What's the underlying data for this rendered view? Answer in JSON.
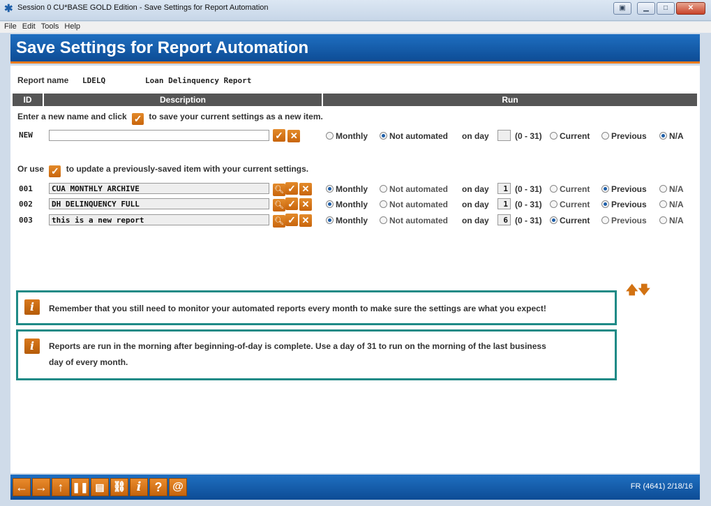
{
  "window": {
    "title": "Session 0 CU*BASE GOLD Edition - Save Settings for Report Automation",
    "menu": [
      "File",
      "Edit",
      "Tools",
      "Help"
    ]
  },
  "page": {
    "title": "Save Settings for Report Automation"
  },
  "report": {
    "name_label": "Report name",
    "code": "LDELQ",
    "description": "Loan Delinquency Report"
  },
  "columns": {
    "id": "ID",
    "description": "Description",
    "run": "Run"
  },
  "new_item": {
    "instruction_before": "Enter a new name and click",
    "instruction_after": "to save your current settings as a new item.",
    "id": "NEW",
    "name_value": "",
    "frequency": "Not automated",
    "day": "",
    "period": "N/A"
  },
  "update": {
    "instruction_before": "Or use",
    "instruction_after": "to update a previously-saved item with your current settings."
  },
  "labels": {
    "monthly": "Monthly",
    "not_automated": "Not automated",
    "on_day": "on day",
    "range": "(0 - 31)",
    "current": "Current",
    "previous": "Previous",
    "na": "N/A"
  },
  "items": [
    {
      "id": "001",
      "name": "CUA MONTHLY ARCHIVE",
      "frequency": "Monthly",
      "day": "1",
      "period": "Previous"
    },
    {
      "id": "002",
      "name": "DH DELINQUENCY FULL",
      "frequency": "Monthly",
      "day": "1",
      "period": "Previous"
    },
    {
      "id": "003",
      "name": "this is a new report",
      "frequency": "Monthly",
      "day": "6",
      "period": "Current"
    }
  ],
  "info": [
    {
      "text": "Remember that you still need to monitor your automated reports every month to make sure the settings are what you expect!"
    },
    {
      "text_line1": "Reports are run in the morning after beginning-of-day is complete.  Use a day of 31 to run on the morning of the last business",
      "text_line2": "day of every month."
    }
  ],
  "footer": {
    "icons": [
      "back-arrow-icon",
      "forward-arrow-icon",
      "up-arrow-icon",
      "pause-icon",
      "print-icon",
      "link-icon",
      "info-icon",
      "help-icon",
      "at-icon"
    ],
    "status": "FR (4641) 2/18/16"
  },
  "colors": {
    "header_blue": "#1565b8",
    "accent_orange": "#e07a1a",
    "info_border": "#1f8a86"
  }
}
